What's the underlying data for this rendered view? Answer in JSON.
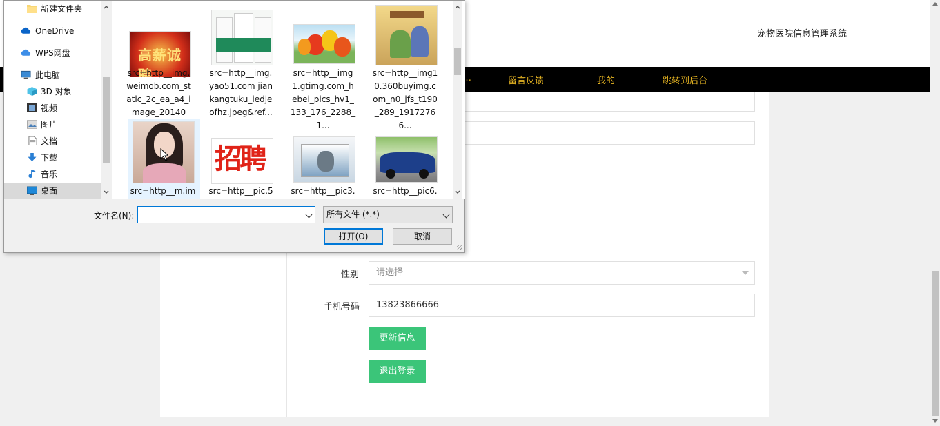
{
  "page": {
    "site_title": "宠物医院信息管理系统",
    "nav": [
      "留言反馈",
      "我的",
      "跳转到后台"
    ],
    "form": {
      "gender_label": "性别",
      "gender_placeholder": "请选择",
      "phone_label": "手机号码",
      "phone_value": "13823866666",
      "update_button": "更新信息",
      "logout_button": "退出登录"
    },
    "accent_color": "#3bc579"
  },
  "dialog": {
    "nav_items": [
      {
        "label": "新建文件夹",
        "icon": "folder-icon"
      },
      {
        "label": "OneDrive",
        "icon": "cloud-icon"
      },
      {
        "label": "WPS网盘",
        "icon": "cloud-icon"
      },
      {
        "label": "此电脑",
        "icon": "computer-icon"
      },
      {
        "label": "3D 对象",
        "icon": "cube-icon"
      },
      {
        "label": "视频",
        "icon": "video-icon"
      },
      {
        "label": "图片",
        "icon": "picture-icon"
      },
      {
        "label": "文档",
        "icon": "document-icon"
      },
      {
        "label": "下载",
        "icon": "download-icon"
      },
      {
        "label": "音乐",
        "icon": "music-icon"
      },
      {
        "label": "桌面",
        "icon": "desktop-icon"
      }
    ],
    "files": [
      {
        "name": "src=http__img.weimob.com_static_2c_ea_a4_image_201402..."
      },
      {
        "name": "src=http__img.yao51.com jiankangtuku_iedjeofhz.jpeg&ref..."
      },
      {
        "name": "src=http__img1.gtimg.com_hebei_pics_hv1_133_176_2288_1..."
      },
      {
        "name": "src=http__img10.360buyimg.com_n0_jfs_t190_289_19172766..."
      },
      {
        "name": "src=http__m.im"
      },
      {
        "name": "src=http__pic.5"
      },
      {
        "name": "src=http__pic3."
      },
      {
        "name": "src=http__pic6."
      }
    ],
    "filename_label": "文件名(N):",
    "filename_value": "",
    "filetype_value": "所有文件 (*.*)",
    "open_button": "打开(O)",
    "cancel_button": "取消",
    "thumb_caption_0": "高薪诚聘",
    "thumb_caption_5": "招聘"
  }
}
